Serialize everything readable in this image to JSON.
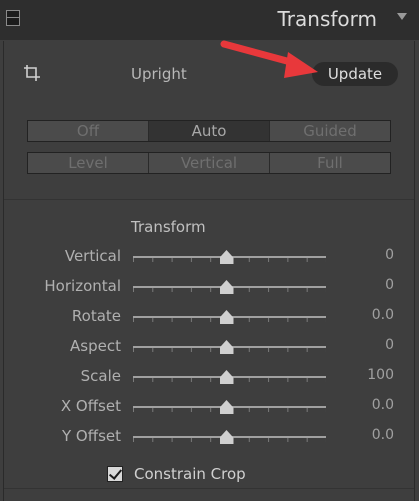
{
  "header": {
    "title": "Transform"
  },
  "upright": {
    "label": "Upright",
    "update_label": "Update",
    "modes_row1": [
      "Off",
      "Auto",
      "Guided"
    ],
    "modes_row2": [
      "Level",
      "Vertical",
      "Full"
    ],
    "active_mode": "Auto"
  },
  "transform": {
    "title": "Transform",
    "sliders": [
      {
        "label": "Vertical",
        "value": "0",
        "position": 0.5
      },
      {
        "label": "Horizontal",
        "value": "0",
        "position": 0.5
      },
      {
        "label": "Rotate",
        "value": "0.0",
        "position": 0.5
      },
      {
        "label": "Aspect",
        "value": "0",
        "position": 0.5
      },
      {
        "label": "Scale",
        "value": "100",
        "position": 0.5
      },
      {
        "label": "X Offset",
        "value": "0.0",
        "position": 0.5
      },
      {
        "label": "Y Offset",
        "value": "0.0",
        "position": 0.5
      }
    ]
  },
  "constrain_crop": {
    "label": "Constrain Crop",
    "checked": true
  },
  "colors": {
    "annotation_arrow": "#e8383b",
    "panel_bg": "#3e3e3e",
    "header_bg": "#2e2e2e"
  }
}
